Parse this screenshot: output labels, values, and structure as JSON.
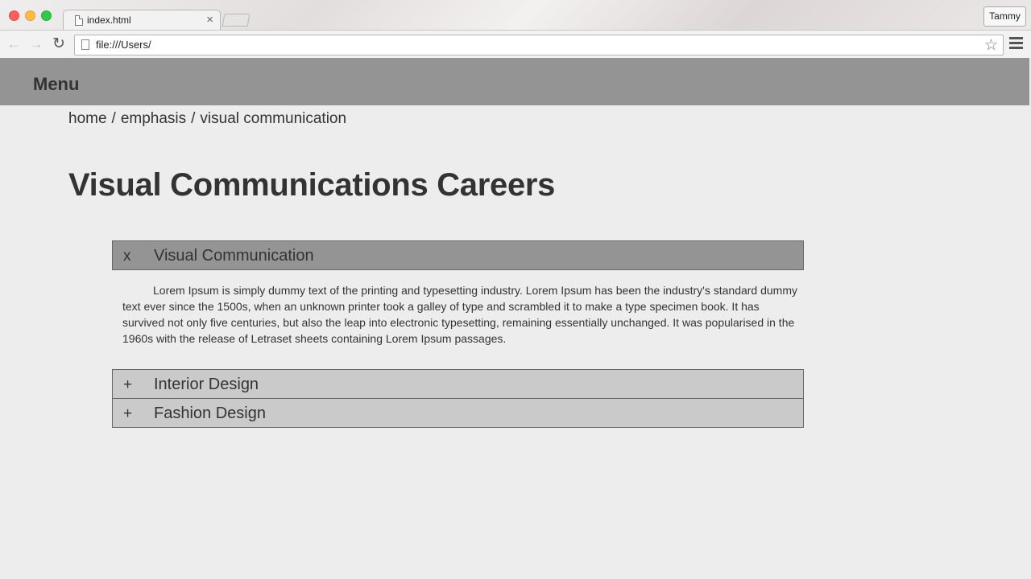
{
  "browser": {
    "tab_title": "index.html",
    "tab_close": "×",
    "profile_name": "Tammy",
    "url": "file:///Users/"
  },
  "header": {
    "menu_label": "Menu"
  },
  "breadcrumb": {
    "items": [
      "home",
      "emphasis",
      "visual communication"
    ],
    "separator": "/"
  },
  "page_title": "Visual Communications Careers",
  "accordion": {
    "items": [
      {
        "toggle": "x",
        "label": "Visual Communication",
        "expanded": true,
        "body": "Lorem Ipsum is simply dummy text of the printing and typesetting industry. Lorem Ipsum has been the industry's standard dummy text ever since the 1500s, when an unknown printer took a galley of type and scrambled it to make a type specimen book. It has survived not only five centuries, but also the leap into electronic typesetting, remaining essentially unchanged. It was popularised in the 1960s with the release of Letraset sheets containing Lorem Ipsum passages."
      },
      {
        "toggle": "+",
        "label": "Interior Design",
        "expanded": false
      },
      {
        "toggle": "+",
        "label": "Fashion Design",
        "expanded": false
      }
    ]
  },
  "colors": {
    "header_bg": "#949494",
    "page_bg": "#ededed",
    "accordion_open_bg": "#949494",
    "accordion_closed_bg": "#cacaca",
    "text": "#333333"
  }
}
